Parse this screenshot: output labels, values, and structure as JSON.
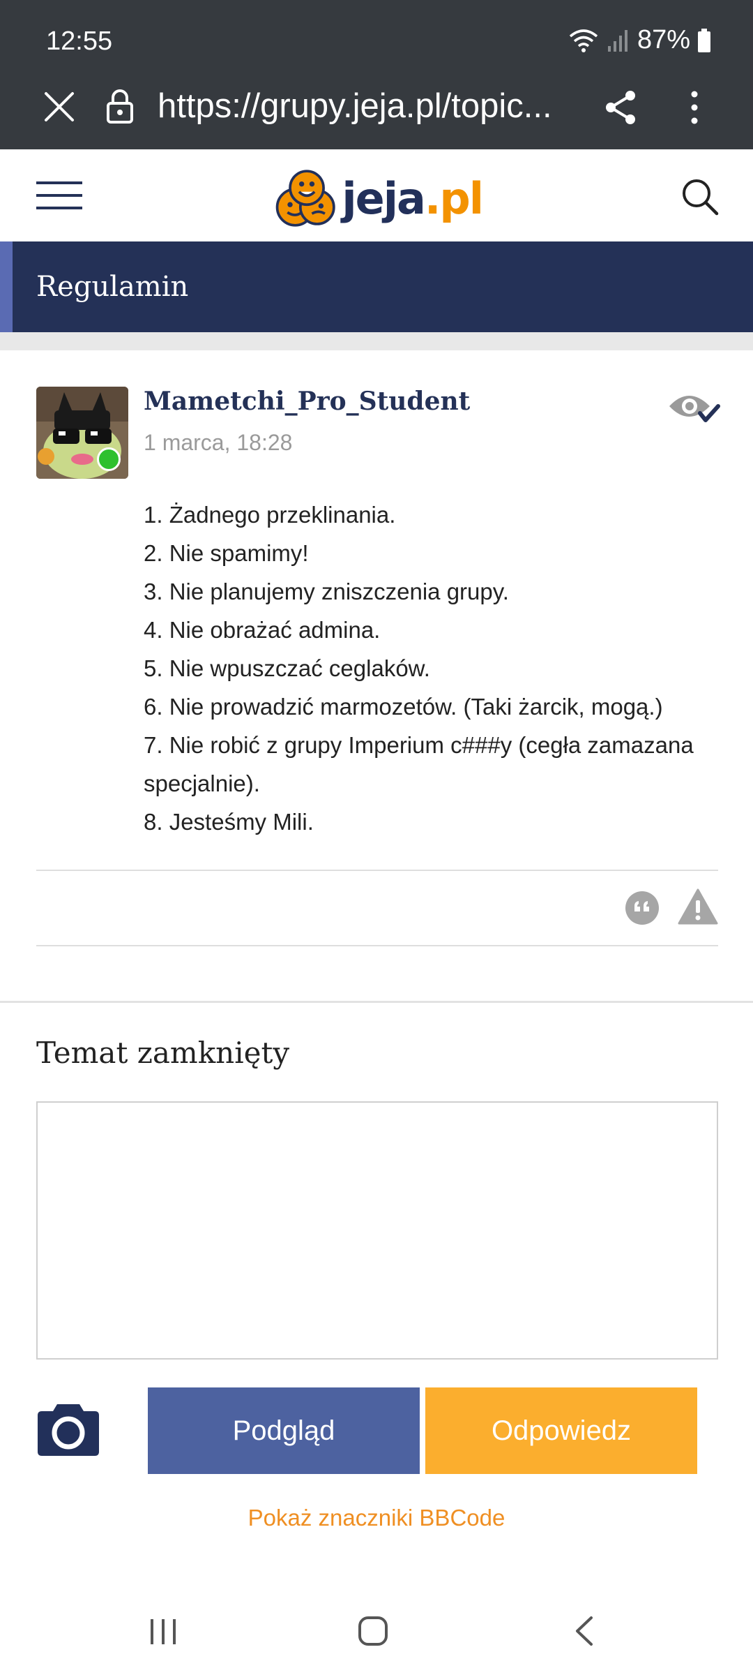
{
  "status_bar": {
    "time": "12:55",
    "battery": "87%"
  },
  "browser": {
    "url": "https://grupy.jeja.pl/topic..."
  },
  "site": {
    "logo_part1": "jeja",
    "logo_part2": ".pl",
    "brand_color": "#22305a",
    "accent_color": "#f39200"
  },
  "topic": {
    "title": "Regulamin"
  },
  "post": {
    "author": "Mametchi_Pro_Student",
    "date": "1 marca, 18:28",
    "online": true,
    "lines": [
      "1. Żadnego przeklinania.",
      "2. Nie spamimy!",
      "3. Nie planujemy zniszczenia grupy.",
      "4. Nie obrażać admina.",
      "5. Nie wpuszczać ceglaków.",
      "6. Nie prowadzić marmozetów. (Taki żarcik, mogą.)",
      "7. Nie robić z grupy Imperium c###y (cegła zamazana specjalnie).",
      "8. Jesteśmy Mili."
    ]
  },
  "reply": {
    "closed_label": "Temat zamknięty",
    "text": "",
    "preview_label": "Podgląd",
    "submit_label": "Odpowiedz",
    "bbcode_link": "Pokaż znaczniki BBCode"
  },
  "icons": {
    "close": "close-icon",
    "lock": "lock-icon",
    "share": "share-icon",
    "more": "more-vert-icon",
    "menu": "hamburger-menu-icon",
    "search": "search-icon",
    "watch": "eye-check-icon",
    "quote": "quote-icon",
    "report": "warning-icon",
    "camera": "camera-icon"
  }
}
